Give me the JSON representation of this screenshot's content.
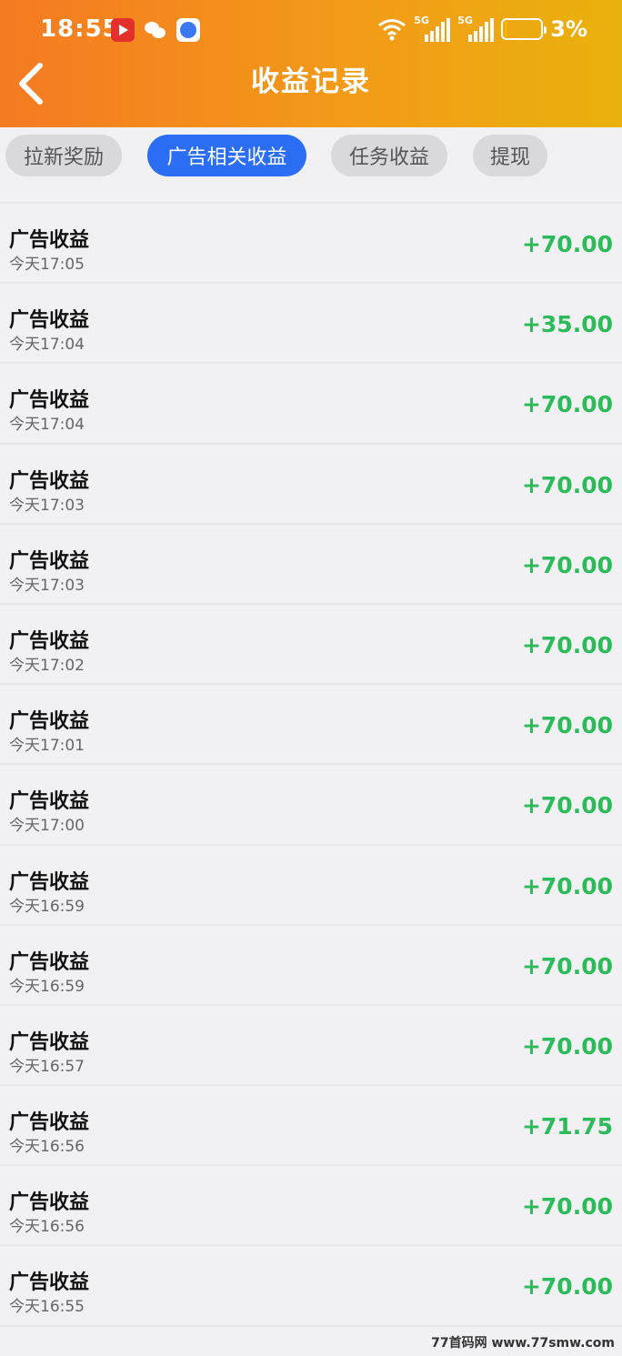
{
  "status_bar": {
    "time": "18:55",
    "battery": "3%",
    "signal_tag": "5G"
  },
  "header": {
    "title": "收益记录"
  },
  "tabs": [
    {
      "label": "拉新奖励",
      "active": false
    },
    {
      "label": "广告相关收益",
      "active": true
    },
    {
      "label": "任务收益",
      "active": false
    },
    {
      "label": "提现",
      "active": false
    }
  ],
  "records": [
    {
      "title": "广告收益",
      "time": "今天17:05",
      "amount": "+70.00"
    },
    {
      "title": "广告收益",
      "time": "今天17:04",
      "amount": "+35.00"
    },
    {
      "title": "广告收益",
      "time": "今天17:04",
      "amount": "+70.00"
    },
    {
      "title": "广告收益",
      "time": "今天17:03",
      "amount": "+70.00"
    },
    {
      "title": "广告收益",
      "time": "今天17:03",
      "amount": "+70.00"
    },
    {
      "title": "广告收益",
      "time": "今天17:02",
      "amount": "+70.00"
    },
    {
      "title": "广告收益",
      "time": "今天17:01",
      "amount": "+70.00"
    },
    {
      "title": "广告收益",
      "time": "今天17:00",
      "amount": "+70.00"
    },
    {
      "title": "广告收益",
      "time": "今天16:59",
      "amount": "+70.00"
    },
    {
      "title": "广告收益",
      "time": "今天16:59",
      "amount": "+70.00"
    },
    {
      "title": "广告收益",
      "time": "今天16:57",
      "amount": "+70.00"
    },
    {
      "title": "广告收益",
      "time": "今天16:56",
      "amount": "+71.75"
    },
    {
      "title": "广告收益",
      "time": "今天16:56",
      "amount": "+70.00"
    },
    {
      "title": "广告收益",
      "time": "今天16:55",
      "amount": "+70.00"
    }
  ],
  "watermark": "77首码网 www.77smw.com",
  "colors": {
    "header_start": "#f47a22",
    "header_end": "#e9b20d",
    "tab_active": "#2b6ef5",
    "amount": "#2dba5a"
  }
}
